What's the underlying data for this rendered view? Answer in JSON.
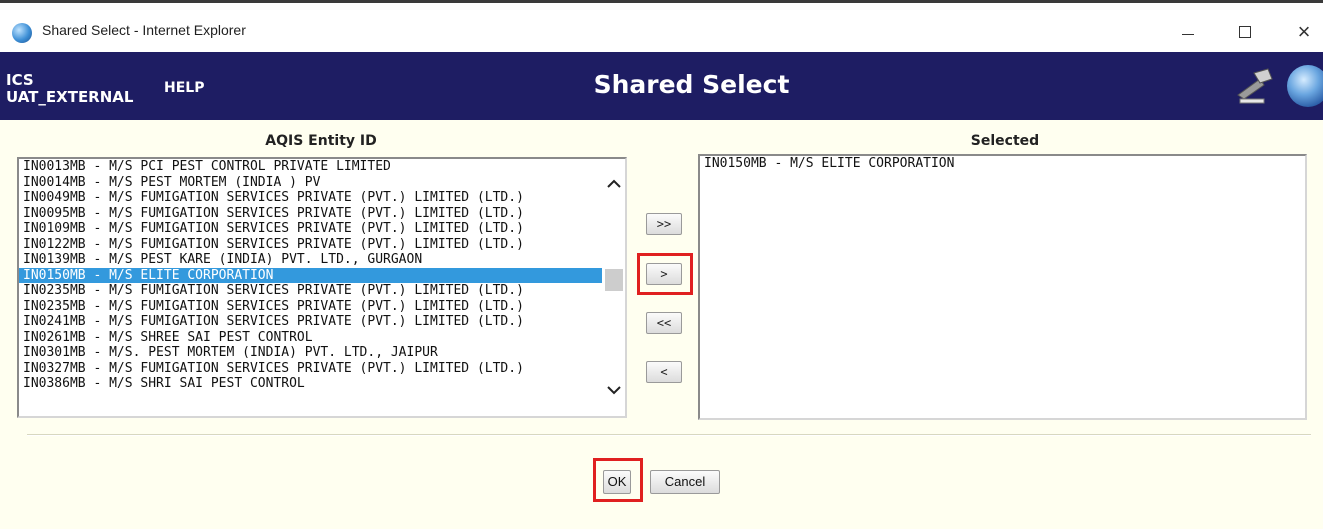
{
  "window": {
    "title": "Shared Select - Internet Explorer",
    "controls": {
      "minimize": "–",
      "maximize": "☐",
      "close": "×"
    }
  },
  "header": {
    "app_name_line1": "ICS",
    "app_name_line2": "UAT_EXTERNAL",
    "help_label": "HELP",
    "title": "Shared Select",
    "icons": [
      "hammer-icon",
      "globe-icon"
    ]
  },
  "available": {
    "heading": "AQIS Entity ID",
    "items": [
      "IN0013MB - M/S PCI PEST CONTROL PRIVATE LIMITED",
      "IN0014MB - M/S PEST MORTEM (INDIA ) PV",
      "IN0049MB - M/S FUMIGATION SERVICES PRIVATE (PVT.) LIMITED (LTD.)",
      "IN0095MB - M/S FUMIGATION SERVICES PRIVATE (PVT.) LIMITED (LTD.)",
      "IN0109MB - M/S FUMIGATION SERVICES PRIVATE (PVT.) LIMITED (LTD.)",
      "IN0122MB - M/S FUMIGATION SERVICES PRIVATE (PVT.) LIMITED (LTD.)",
      "IN0139MB - M/S PEST KARE (INDIA) PVT. LTD., GURGAON",
      "IN0150MB - M/S ELITE CORPORATION",
      "IN0235MB - M/S FUMIGATION SERVICES PRIVATE (PVT.) LIMITED (LTD.)",
      "IN0235MB - M/S FUMIGATION SERVICES PRIVATE (PVT.) LIMITED (LTD.)",
      "IN0241MB - M/S FUMIGATION SERVICES PRIVATE (PVT.) LIMITED (LTD.)",
      "IN0261MB - M/S SHREE SAI PEST CONTROL",
      "IN0301MB - M/S. PEST MORTEM (INDIA) PVT. LTD., JAIPUR",
      "IN0327MB - M/S FUMIGATION SERVICES PRIVATE (PVT.) LIMITED (LTD.)",
      "IN0386MB - M/S SHRI SAI PEST CONTROL"
    ],
    "selected_index": 7,
    "scroll_up_glyph": "^",
    "scroll_down_glyph": "v"
  },
  "selected": {
    "heading": "Selected",
    "items": [
      "IN0150MB - M/S ELITE CORPORATION"
    ]
  },
  "move_buttons": {
    "add_all": ">>",
    "add": ">",
    "remove_all": "<<",
    "remove": "<"
  },
  "actions": {
    "ok": "OK",
    "cancel": "Cancel"
  },
  "colors": {
    "header_bg": "#1e1d63",
    "panel_bg": "#fffff0",
    "selection_bg": "#3399dd",
    "highlight_border": "#e02020"
  }
}
